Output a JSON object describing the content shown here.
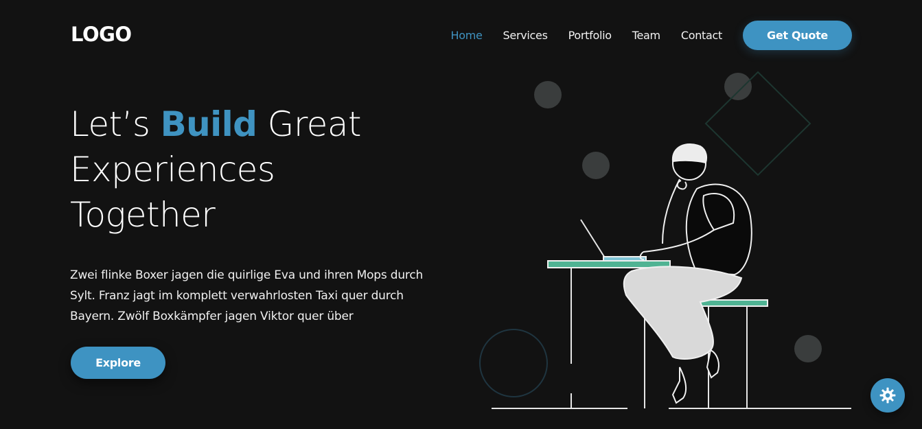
{
  "header": {
    "logo": "LOGO",
    "nav": {
      "home": "Home",
      "services": "Services",
      "portfolio": "Portfolio",
      "team": "Team",
      "contact": "Contact"
    },
    "cta_label": "Get Quote"
  },
  "hero": {
    "title_pre": "Let’s ",
    "title_accent": "Build",
    "title_post": " Great",
    "title_line2": "Experiences",
    "title_line3": "Together",
    "lead": "Zwei flinke Boxer jagen die quirlige Eva und ihren Mops durch Sylt. Franz jagt im komplett verwahrlosten Taxi quer durch Bayern. Zwölf Boxkämpfer jagen Viktor quer über",
    "button_label": "Explore"
  },
  "colors": {
    "accent": "#3e93c2",
    "background": "#121212",
    "table_top": "#4fb393"
  },
  "icons": {
    "fab": "gear-icon"
  }
}
